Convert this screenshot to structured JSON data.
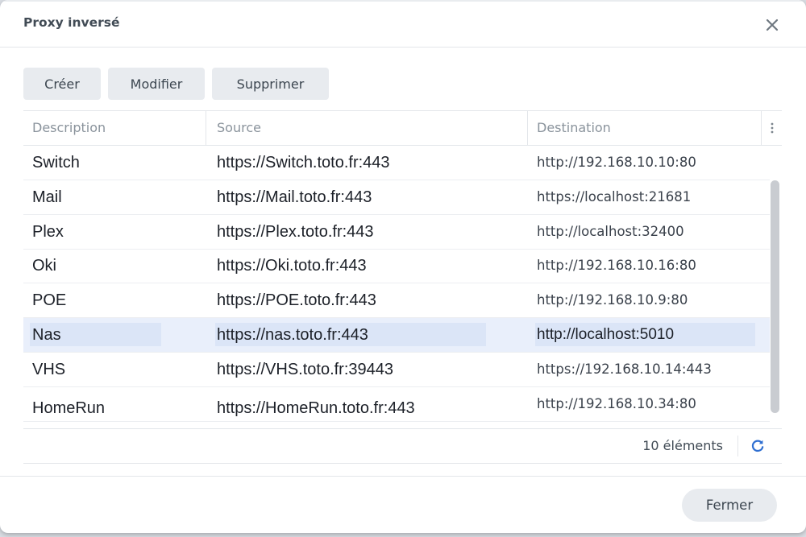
{
  "dialog": {
    "title": "Proxy inversé"
  },
  "toolbar": {
    "create_label": "Créer",
    "edit_label": "Modifier",
    "delete_label": "Supprimer"
  },
  "table": {
    "columns": [
      "Description",
      "Source",
      "Destination"
    ],
    "rows": [
      {
        "description": "Switch",
        "source": "https://Switch.toto.fr:443",
        "destination": "http://192.168.10.10:80"
      },
      {
        "description": "Mail",
        "source": "https://Mail.toto.fr:443",
        "destination": "https://localhost:21681"
      },
      {
        "description": "Plex",
        "source": "https://Plex.toto.fr:443",
        "destination": "http://localhost:32400"
      },
      {
        "description": "Oki",
        "source": "https://Oki.toto.fr:443",
        "destination": "http://192.168.10.16:80"
      },
      {
        "description": "POE",
        "source": "https://POE.toto.fr:443",
        "destination": "http://192.168.10.9:80"
      },
      {
        "description": "Nas",
        "source": "https://nas.toto.fr:443",
        "destination": "http://localhost:5010",
        "selected": true
      },
      {
        "description": "VHS",
        "source": "https://VHS.toto.fr:39443",
        "destination": "https://192.168.10.14:443"
      },
      {
        "description": "HomeRun",
        "source": "https://HomeRun.toto.fr:443",
        "destination": "http://192.168.10.34:80"
      }
    ],
    "count_text": "10 éléments"
  },
  "icons": {
    "close": "close-icon",
    "more": "vertical-dots-icon",
    "refresh": "refresh-icon"
  },
  "footer": {
    "close_label": "Fermer"
  },
  "colors": {
    "accent": "#2f6fd1",
    "selected_row": "#e9effb",
    "button_bg": "#e8ebef"
  }
}
